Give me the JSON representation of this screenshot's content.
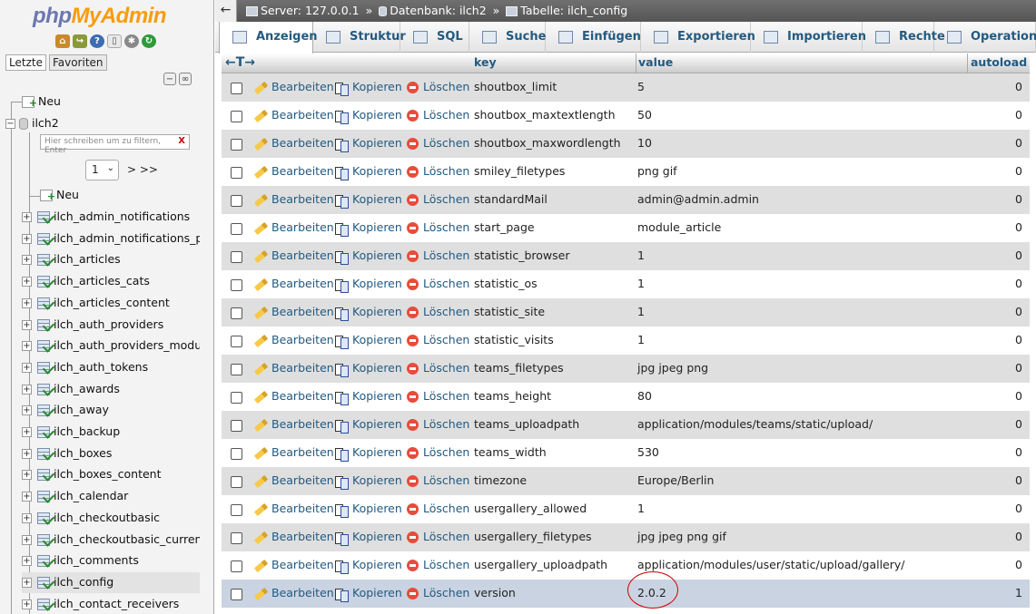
{
  "nav": {
    "logo": {
      "php": "php",
      "myadmin": "MyAdmin"
    },
    "icons": [
      "home-icon",
      "exit-icon",
      "help-icon",
      "docs-icon",
      "settings-icon",
      "reload-icon"
    ],
    "tabs": {
      "recent": "Letzte",
      "favorites": "Favoriten"
    },
    "root_new": "Neu",
    "database": "ilch2",
    "filter_placeholder": "Hier schreiben um zu filtern, Enter",
    "filter_clear": "X",
    "page_select": "1",
    "page_next": "> >>",
    "db_new": "Neu",
    "tables": [
      "ilch_admin_notifications",
      "ilch_admin_notifications_pe",
      "ilch_articles",
      "ilch_articles_cats",
      "ilch_articles_content",
      "ilch_auth_providers",
      "ilch_auth_providers_module",
      "ilch_auth_tokens",
      "ilch_awards",
      "ilch_away",
      "ilch_backup",
      "ilch_boxes",
      "ilch_boxes_content",
      "ilch_calendar",
      "ilch_checkoutbasic",
      "ilch_checkoutbasic_currenc",
      "ilch_comments",
      "ilch_config",
      "ilch_contact_receivers"
    ],
    "active_table_index": 17
  },
  "breadcrumb": {
    "back": "←",
    "server": "Server: 127.0.0.1",
    "sep": "»",
    "database": "Datenbank: ilch2",
    "table": "Tabelle: ilch_config"
  },
  "tabs": [
    {
      "label": "Anzeigen",
      "icon": "browse-icon"
    },
    {
      "label": "Struktur",
      "icon": "structure-icon"
    },
    {
      "label": "SQL",
      "icon": "sql-icon"
    },
    {
      "label": "Suche",
      "icon": "search-icon"
    },
    {
      "label": "Einfügen",
      "icon": "insert-icon"
    },
    {
      "label": "Exportieren",
      "icon": "export-icon"
    },
    {
      "label": "Importieren",
      "icon": "import-icon"
    },
    {
      "label": "Rechte",
      "icon": "privileges-icon"
    },
    {
      "label": "Operation",
      "icon": "operations-icon"
    }
  ],
  "grid": {
    "arrows": "←T→",
    "columns": [
      "key",
      "value",
      "autoload"
    ],
    "actions": {
      "edit": "Bearbeiten",
      "copy": "Kopieren",
      "delete": "Löschen"
    },
    "rows": [
      {
        "key": "shoutbox_limit",
        "value": "5",
        "autoload": "0"
      },
      {
        "key": "shoutbox_maxtextlength",
        "value": "50",
        "autoload": "0"
      },
      {
        "key": "shoutbox_maxwordlength",
        "value": "10",
        "autoload": "0"
      },
      {
        "key": "smiley_filetypes",
        "value": "png gif",
        "autoload": "0"
      },
      {
        "key": "standardMail",
        "value": "admin@admin.admin",
        "autoload": "0"
      },
      {
        "key": "start_page",
        "value": "module_article",
        "autoload": "0"
      },
      {
        "key": "statistic_browser",
        "value": "1",
        "autoload": "0"
      },
      {
        "key": "statistic_os",
        "value": "1",
        "autoload": "0"
      },
      {
        "key": "statistic_site",
        "value": "1",
        "autoload": "0"
      },
      {
        "key": "statistic_visits",
        "value": "1",
        "autoload": "0"
      },
      {
        "key": "teams_filetypes",
        "value": "jpg jpeg png",
        "autoload": "0"
      },
      {
        "key": "teams_height",
        "value": "80",
        "autoload": "0"
      },
      {
        "key": "teams_uploadpath",
        "value": "application/modules/teams/static/upload/",
        "autoload": "0"
      },
      {
        "key": "teams_width",
        "value": "530",
        "autoload": "0"
      },
      {
        "key": "timezone",
        "value": "Europe/Berlin",
        "autoload": "0"
      },
      {
        "key": "usergallery_allowed",
        "value": "1",
        "autoload": "0"
      },
      {
        "key": "usergallery_filetypes",
        "value": "jpg jpeg png gif",
        "autoload": "0"
      },
      {
        "key": "usergallery_uploadpath",
        "value": "application/modules/user/static/upload/gallery/",
        "autoload": "0"
      },
      {
        "key": "version",
        "value": "2.0.2",
        "autoload": "1"
      }
    ],
    "highlighted_row_index": 18,
    "annotation_color": "#d10000"
  }
}
